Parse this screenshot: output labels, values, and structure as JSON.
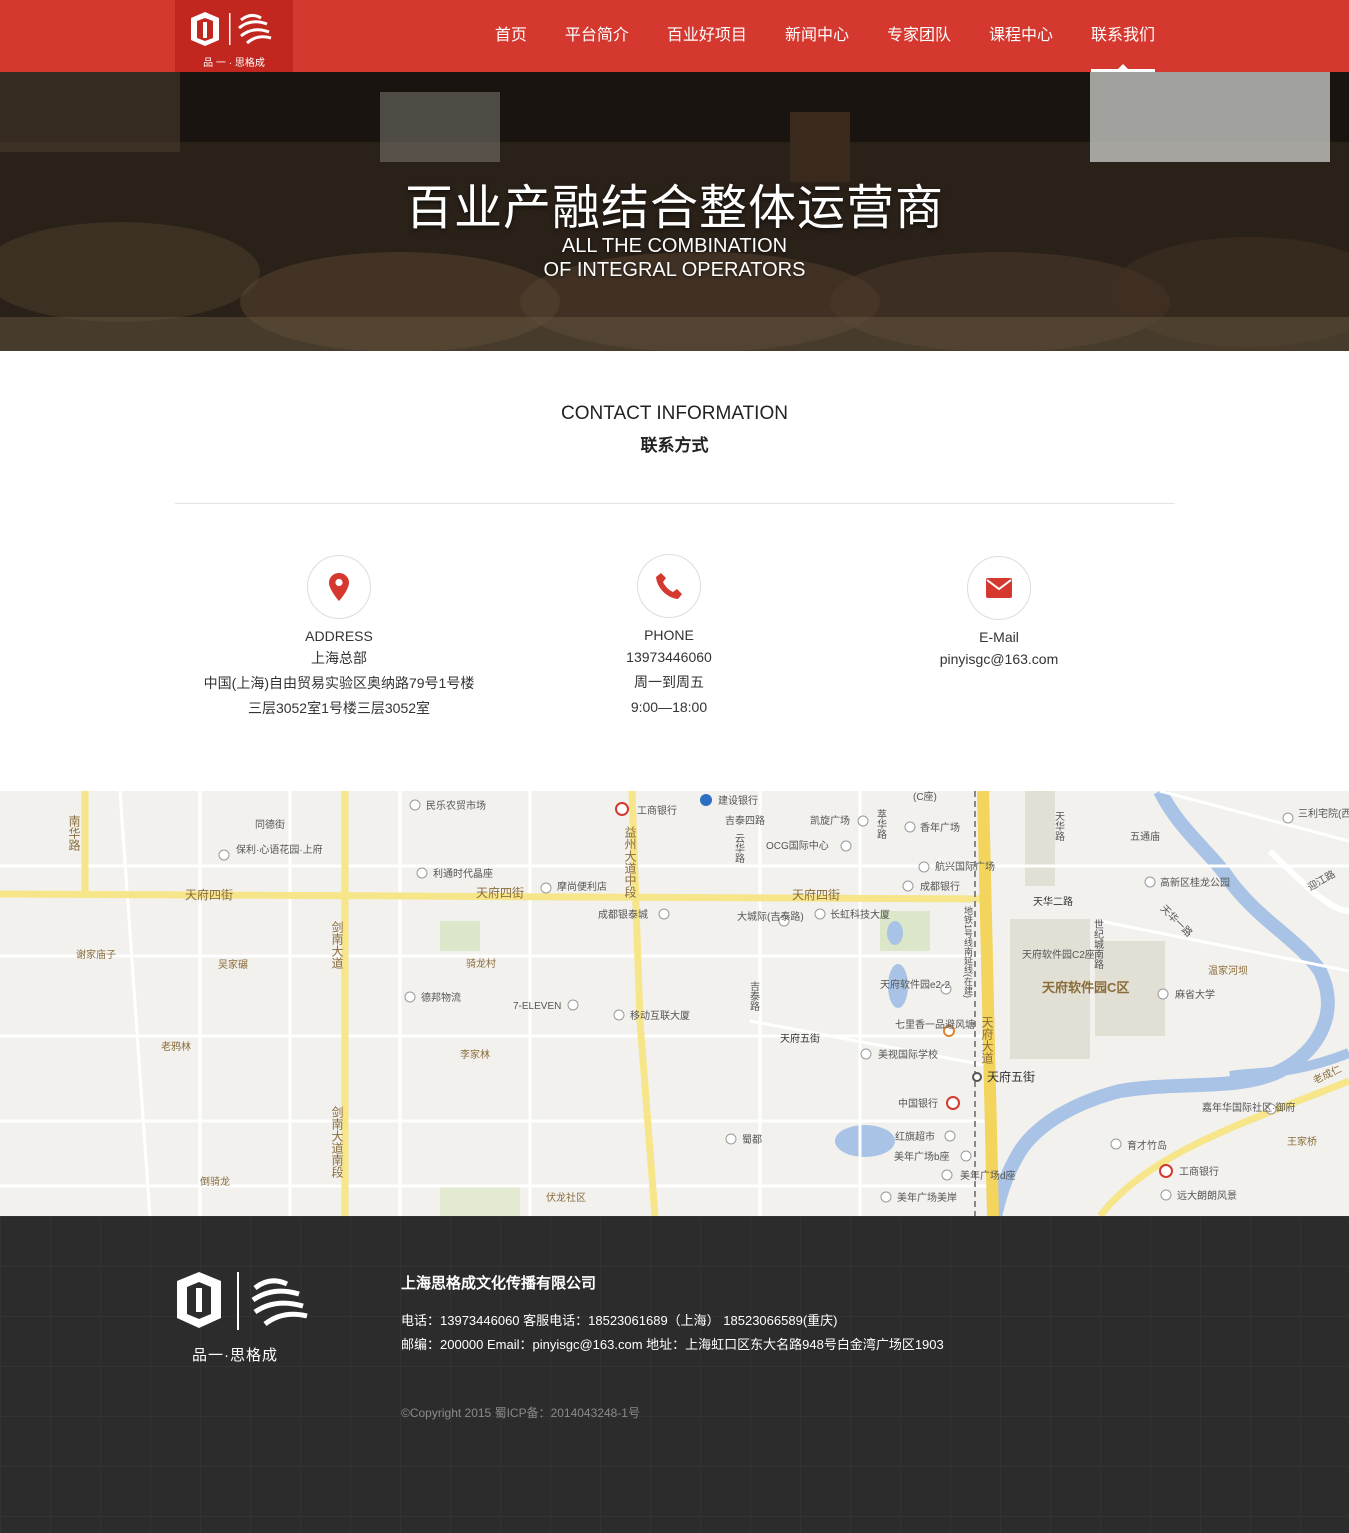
{
  "header": {
    "logo_text": "品 一 · 思格成",
    "nav": [
      {
        "label": "首页"
      },
      {
        "label": "平台简介"
      },
      {
        "label": "百业好项目"
      },
      {
        "label": "新闻中心"
      },
      {
        "label": "专家团队"
      },
      {
        "label": "课程中心"
      },
      {
        "label": "联系我们"
      }
    ],
    "active_nav": "联系我们",
    "brand_color": "#d4382f"
  },
  "banner": {
    "title": "百业产融结合整体运营商",
    "subtitle_line1": "ALL THE COMBINATION",
    "subtitle_line2": "OF INTEGRAL OPERATORS"
  },
  "contact": {
    "title_en": "CONTACT INFORMATION",
    "title_cn": "联系方式",
    "address": {
      "icon": "map-pin-icon",
      "label": "ADDRESS",
      "line1": "上海总部",
      "line2": "中国(上海)自由贸易实验区奥纳路79号1号楼",
      "line3": "三层3052室1号楼三层3052室"
    },
    "phone": {
      "icon": "phone-icon",
      "label": "PHONE",
      "line1": "13973446060",
      "line2": "周一到周五",
      "line3": "9:00—18:00"
    },
    "email": {
      "icon": "envelope-icon",
      "label": "E-Mail",
      "line1": "pinyisgc@163.com"
    },
    "icon_color": "#d4382f"
  },
  "map": {
    "labels": {
      "nanhua": "南华路",
      "tongde": "同德街",
      "baoli": "保利·心语花园·上府",
      "minle": "民乐农贸市场",
      "litong": "利通时代晶座",
      "tianfu4_a": "天府四街",
      "tianfu4_b": "天府四街",
      "tianfu4_c": "天府四街",
      "jiannan": "剑南大道",
      "moshang": "摩尚便利店",
      "gongshang1": "工商银行",
      "yizhou": "益州大道中段",
      "jianshe": "建设银行",
      "jitai4": "吉泰四路",
      "yunhua": "云华路",
      "kaixuan": "凯旋广场",
      "ocg": "OCG国际中心",
      "cuihua": "萃华路",
      "cseat": "(C座)",
      "xiangnian": "香年广场",
      "hangxing": "航兴国际广场",
      "chengdu_bank": "成都银行",
      "tianfu_ave": "天府大道",
      "tianhua": "天华路",
      "tianhua2": "天华二路",
      "wutong": "五通庙",
      "sanli": "三利宅院(西区)",
      "gaoxin": "高新区桂龙公园",
      "yingjiang": "迎江路",
      "tianhua1": "天华一路",
      "shiji": "世纪城南路",
      "software_c2": "天府软件园C2座",
      "software_c": "天府软件园C区",
      "wenjia": "温家河坝",
      "mashen": "麻省大学",
      "xiejia": "谢家庙子",
      "wujia": "吴家碾",
      "qilong": "骑龙村",
      "debang": "德邦物流",
      "chengdu_yin": "成都银泰城",
      "dacheng": "大城际(吉泰路)",
      "changhong": "长虹科技大厦",
      "eleven": "7-ELEVEN",
      "yidong": "移动互联大厦",
      "jitai": "吉泰路",
      "software_e2": "天府软件园e2-2",
      "qilixiang": "七里香一品避风塘",
      "tianfu5": "天府五街",
      "tianfu5_st": "天府五街",
      "meishi": "美视国际学校",
      "metro": "地铁1号线南延线(在建)",
      "laoya": "老鸦林",
      "lijia": "李家林",
      "zhongguo": "中国银行",
      "hongqi": "红旗超市",
      "meinian_b": "美年广场b座",
      "meinian_d": "美年广场d座",
      "meinian": "美年广场美岸",
      "shudu": "蜀都",
      "jiannian": "嘉年华国际社区·御府",
      "yucai": "育才竹岛",
      "gongshang2": "工商银行",
      "yuanda": "远大朗朗风景",
      "wangjia": "王家桥",
      "daoqi": "倒骑龙",
      "jiannan_s": "剑南大道南段",
      "fulong": "伏龙社区",
      "laocheng": "老成仁"
    }
  },
  "footer": {
    "logo_text": "品一·思格成",
    "company": "上海思格成文化传播有限公司",
    "line1": "电话：13973446060    客服电话：18523061689（上海）  18523066589(重庆)",
    "line2": "邮编：200000   Email：pinyisgc@163.com    地址：上海虹口区东大名路948号白金湾广场区1903",
    "copyright": "©Copyright 2015 蜀ICP备：2014043248-1号"
  }
}
